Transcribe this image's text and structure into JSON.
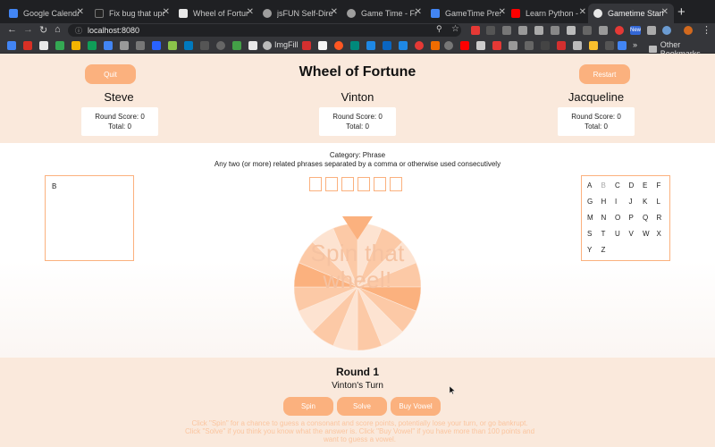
{
  "browser": {
    "tabs": [
      {
        "label": "Google Calendar",
        "icon_color": "#4285f4"
      },
      {
        "label": "Fix bug that upda",
        "icon_color": "#222222"
      },
      {
        "label": "Wheel of Fortune",
        "icon_color": "#e8e8e8"
      },
      {
        "label": "jsFUN Self-Directi",
        "icon_color": "#9e9e9e"
      },
      {
        "label": "Game Time - Fron",
        "icon_color": "#9e9e9e"
      },
      {
        "label": "GameTime Presen",
        "icon_color": "#4285f4"
      },
      {
        "label": "Learn Python - Fu",
        "icon_color": "#ff0000"
      },
      {
        "label": "Gametime Starter",
        "icon_color": "#e8e8e8"
      }
    ],
    "url": "localhost:8080",
    "bookmarks": {
      "imgfill_label": "ImgFill",
      "other_bookmarks_label": "Other Bookmarks"
    },
    "new_badge": "New"
  },
  "game": {
    "title": "Wheel of Fortune",
    "quit_label": "Quit",
    "restart_label": "Restart",
    "players": [
      {
        "name": "Steve",
        "round_score": "Round Score: 0",
        "total": "Total: 0"
      },
      {
        "name": "Vinton",
        "round_score": "Round Score: 0",
        "total": "Total: 0"
      },
      {
        "name": "Jacqueline",
        "round_score": "Round Score: 0",
        "total": "Total: 0"
      }
    ],
    "category": "Category: Phrase",
    "hint": "Any two (or more) related phrases separated by a comma or otherwise used consecutively",
    "guessed_letters": "B",
    "alphabet": [
      {
        "letter": "A",
        "used": false
      },
      {
        "letter": "B",
        "used": true
      },
      {
        "letter": "C",
        "used": false
      },
      {
        "letter": "D",
        "used": false
      },
      {
        "letter": "E",
        "used": false
      },
      {
        "letter": "F",
        "used": false
      },
      {
        "letter": "G",
        "used": false
      },
      {
        "letter": "H",
        "used": false
      },
      {
        "letter": "I",
        "used": false
      },
      {
        "letter": "J",
        "used": false
      },
      {
        "letter": "K",
        "used": false
      },
      {
        "letter": "L",
        "used": false
      },
      {
        "letter": "M",
        "used": false
      },
      {
        "letter": "N",
        "used": false
      },
      {
        "letter": "O",
        "used": false
      },
      {
        "letter": "P",
        "used": false
      },
      {
        "letter": "Q",
        "used": false
      },
      {
        "letter": "R",
        "used": false
      },
      {
        "letter": "S",
        "used": false
      },
      {
        "letter": "T",
        "used": false
      },
      {
        "letter": "U",
        "used": false
      },
      {
        "letter": "V",
        "used": false
      },
      {
        "letter": "W",
        "used": false
      },
      {
        "letter": "X",
        "used": false
      },
      {
        "letter": "Y",
        "used": false
      },
      {
        "letter": "Z",
        "used": false
      }
    ],
    "wheel_line1": "Spin that",
    "wheel_line2": "wheel!",
    "round_title": "Round 1",
    "turn_text": "Vinton's Turn",
    "spin_label": "Spin",
    "solve_label": "Solve",
    "buy_vowel_label": "Buy Vowel",
    "instructions": "Click \"Spin\" for a chance to guess a consonant and score points, potentially lose your turn, or go bankrupt. Click \"Solve\" if you think you know what the answer is. Click \"Buy Vowel\" if you have more than 100 points and want to guess a vowel."
  },
  "colors": {
    "accent": "#fbb17e",
    "band": "#fae9dc",
    "wheel_light": "#fde3d1",
    "wheel_mid": "#fcc9a6",
    "wheel_dark": "#fbb17e",
    "instructions": "#fbc59f"
  }
}
